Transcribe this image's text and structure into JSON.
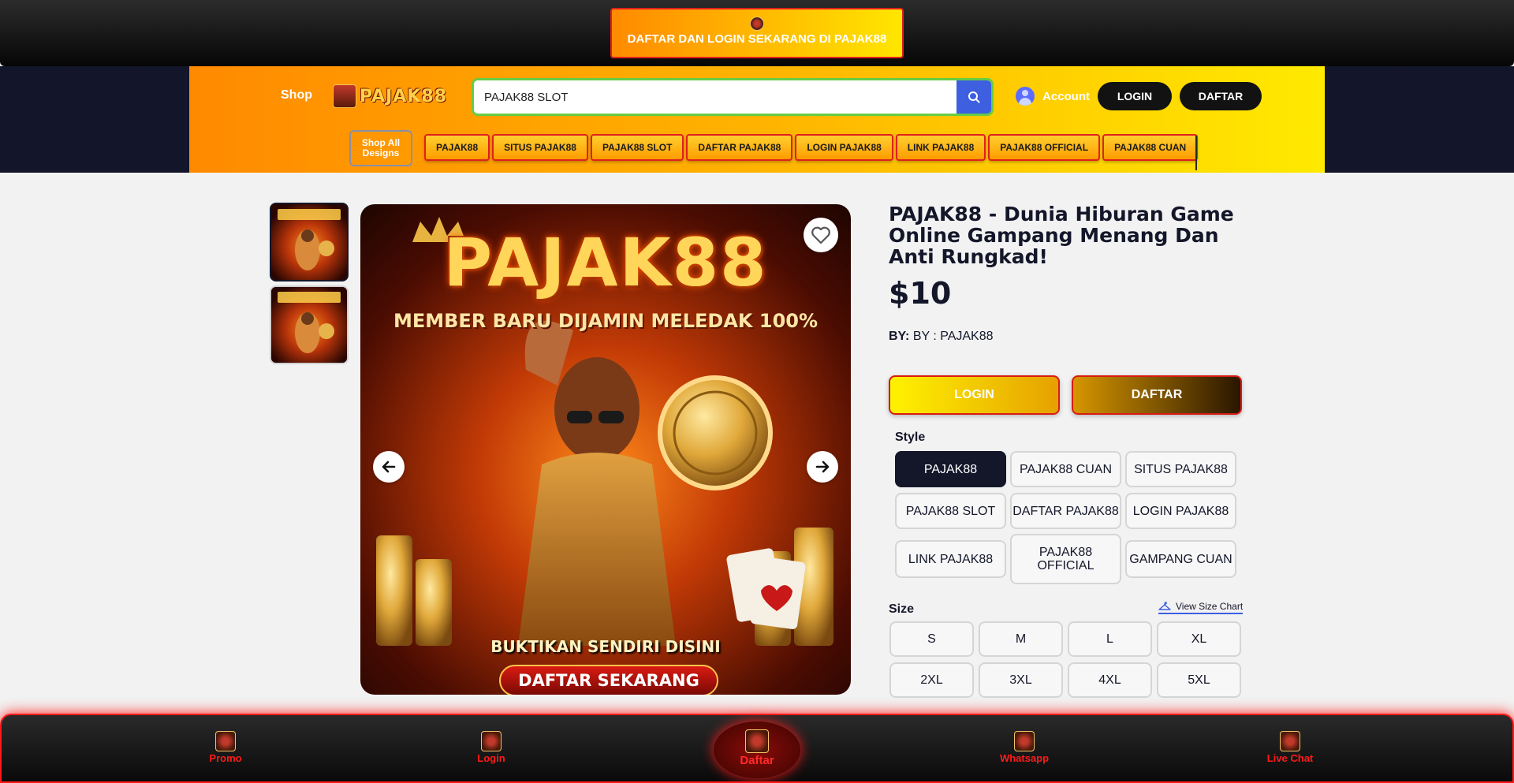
{
  "top_banner": {
    "text": "DAFTAR DAN LOGIN  SEKARANG DI PAJAK88",
    "logo_icon": "pajak88-mascot-icon"
  },
  "header": {
    "shop_label": "Shop",
    "brand": "PAJAK88",
    "search": {
      "value": "PAJAK88 SLOT",
      "placeholder": "Search"
    },
    "account_label": "Account",
    "login_label": "LOGIN",
    "daftar_label": "DAFTAR",
    "shop_all_label": "Shop All Designs",
    "categories": [
      "PAJAK88",
      "SITUS PAJAK88",
      "PAJAK88 SLOT",
      "DAFTAR PAJAK88",
      "LOGIN PAJAK88",
      "LINK PAJAK88",
      "PAJAK88 OFFICIAL",
      "PAJAK88 CUAN"
    ]
  },
  "gallery": {
    "poster": {
      "title": "PAJAK88",
      "subtitle": "MEMBER BARU DIJAMIN MELEDAK 100%",
      "bottom_text": "BUKTIKAN SENDIRI DISINI",
      "cta": "DAFTAR SEKARANG"
    }
  },
  "product": {
    "name": "PAJAK88 - Dunia Hiburan Game Online Gampang Menang Dan Anti Rungkad!",
    "price": "$10",
    "by_label": "BY:",
    "by_value": "BY : PAJAK88",
    "login_button": "LOGIN",
    "daftar_button": "DAFTAR",
    "style_label": "Style",
    "styles": [
      "PAJAK88",
      "PAJAK88 CUAN",
      "SITUS PAJAK88",
      "PAJAK88 SLOT",
      "DAFTAR PAJAK88",
      "LOGIN PAJAK88",
      "LINK PAJAK88",
      "PAJAK88 OFFICIAL",
      "GAMPANG CUAN"
    ],
    "selected_style": "PAJAK88",
    "size_label": "Size",
    "size_chart_label": "View Size Chart",
    "sizes": [
      "S",
      "M",
      "L",
      "XL",
      "2XL",
      "3XL",
      "4XL",
      "5XL"
    ]
  },
  "bottom_nav": {
    "items": [
      "Promo",
      "Login",
      "Daftar",
      "Whatsapp",
      "Live Chat"
    ]
  },
  "colors": {
    "header_gradient_start": "#ff8a00",
    "header_gradient_end": "#ffea00",
    "dark": "#14172a",
    "accent_red": "#ff1a1a",
    "search_button": "#3d5fe0"
  }
}
